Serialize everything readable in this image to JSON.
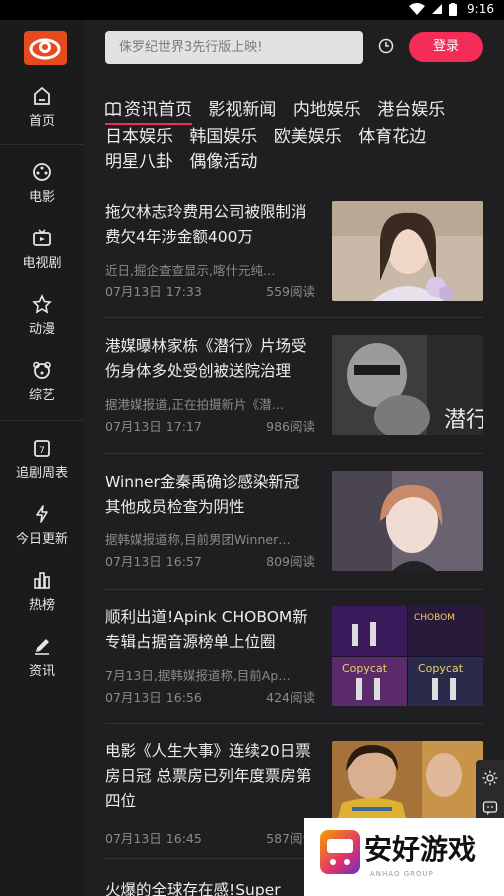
{
  "status_bar": {
    "time": "9:16"
  },
  "search": {
    "placeholder": "侏罗纪世界3先行版上映!"
  },
  "header": {
    "login_label": "登录"
  },
  "sidebar": {
    "items": [
      {
        "label": "首页",
        "icon": "home-icon"
      },
      {
        "label": "电影",
        "icon": "film-reel-icon"
      },
      {
        "label": "电视剧",
        "icon": "tv-icon"
      },
      {
        "label": "动漫",
        "icon": "star-icon"
      },
      {
        "label": "综艺",
        "icon": "bear-icon"
      },
      {
        "label": "追剧周表",
        "icon": "calendar-icon"
      },
      {
        "label": "今日更新",
        "icon": "lightning-icon"
      },
      {
        "label": "热榜",
        "icon": "chart-icon"
      },
      {
        "label": "资讯",
        "icon": "pencil-icon"
      }
    ]
  },
  "tabs": [
    {
      "label": "资讯首页",
      "active": true
    },
    {
      "label": "影视新闻"
    },
    {
      "label": "内地娱乐"
    },
    {
      "label": "港台娱乐"
    },
    {
      "label": "日本娱乐"
    },
    {
      "label": "韩国娱乐"
    },
    {
      "label": "欧美娱乐"
    },
    {
      "label": "体育花边"
    },
    {
      "label": "明星八卦"
    },
    {
      "label": "偶像活动"
    }
  ],
  "articles": [
    {
      "title": "拖欠林志玲费用公司被限制消费欠4年涉金额400万",
      "summary": "近日,掘企查查显示,喀什元纯…",
      "date": "07月13日 17:33",
      "reads": "559阅读"
    },
    {
      "title": "港媒曝林家栋《潜行》片场受伤身体多处受创被送院治理",
      "summary": "据港媒报道,正在拍摄新片《潜…",
      "date": "07月13日 17:17",
      "reads": "986阅读"
    },
    {
      "title": "Winner金秦禹确诊感染新冠 其他成员检查为阴性",
      "summary": "据韩媒报道称,目前男团Winner…",
      "date": "07月13日 16:57",
      "reads": "809阅读"
    },
    {
      "title": "顺利出道!Apink CHOBOM新专辑占据音源榜单上位圈",
      "summary": "7月13日,据韩媒报道称,目前Ap…",
      "date": "07月13日 16:56",
      "reads": "424阅读"
    },
    {
      "title": "电影《人生大事》连续20日票房日冠 总票房已列年度票房第四位",
      "summary": "",
      "date": "07月13日 16:45",
      "reads": "587阅读"
    },
    {
      "title": "火爆的全球存在感!Super",
      "summary": "",
      "date": "",
      "reads": ""
    }
  ],
  "watermark": {
    "text": "安好游戏",
    "sub": "ANHAO GROUP"
  },
  "colors": {
    "accent": "#f42c58",
    "background": "#1f1f21",
    "sidebar": "#1b1b1c"
  }
}
